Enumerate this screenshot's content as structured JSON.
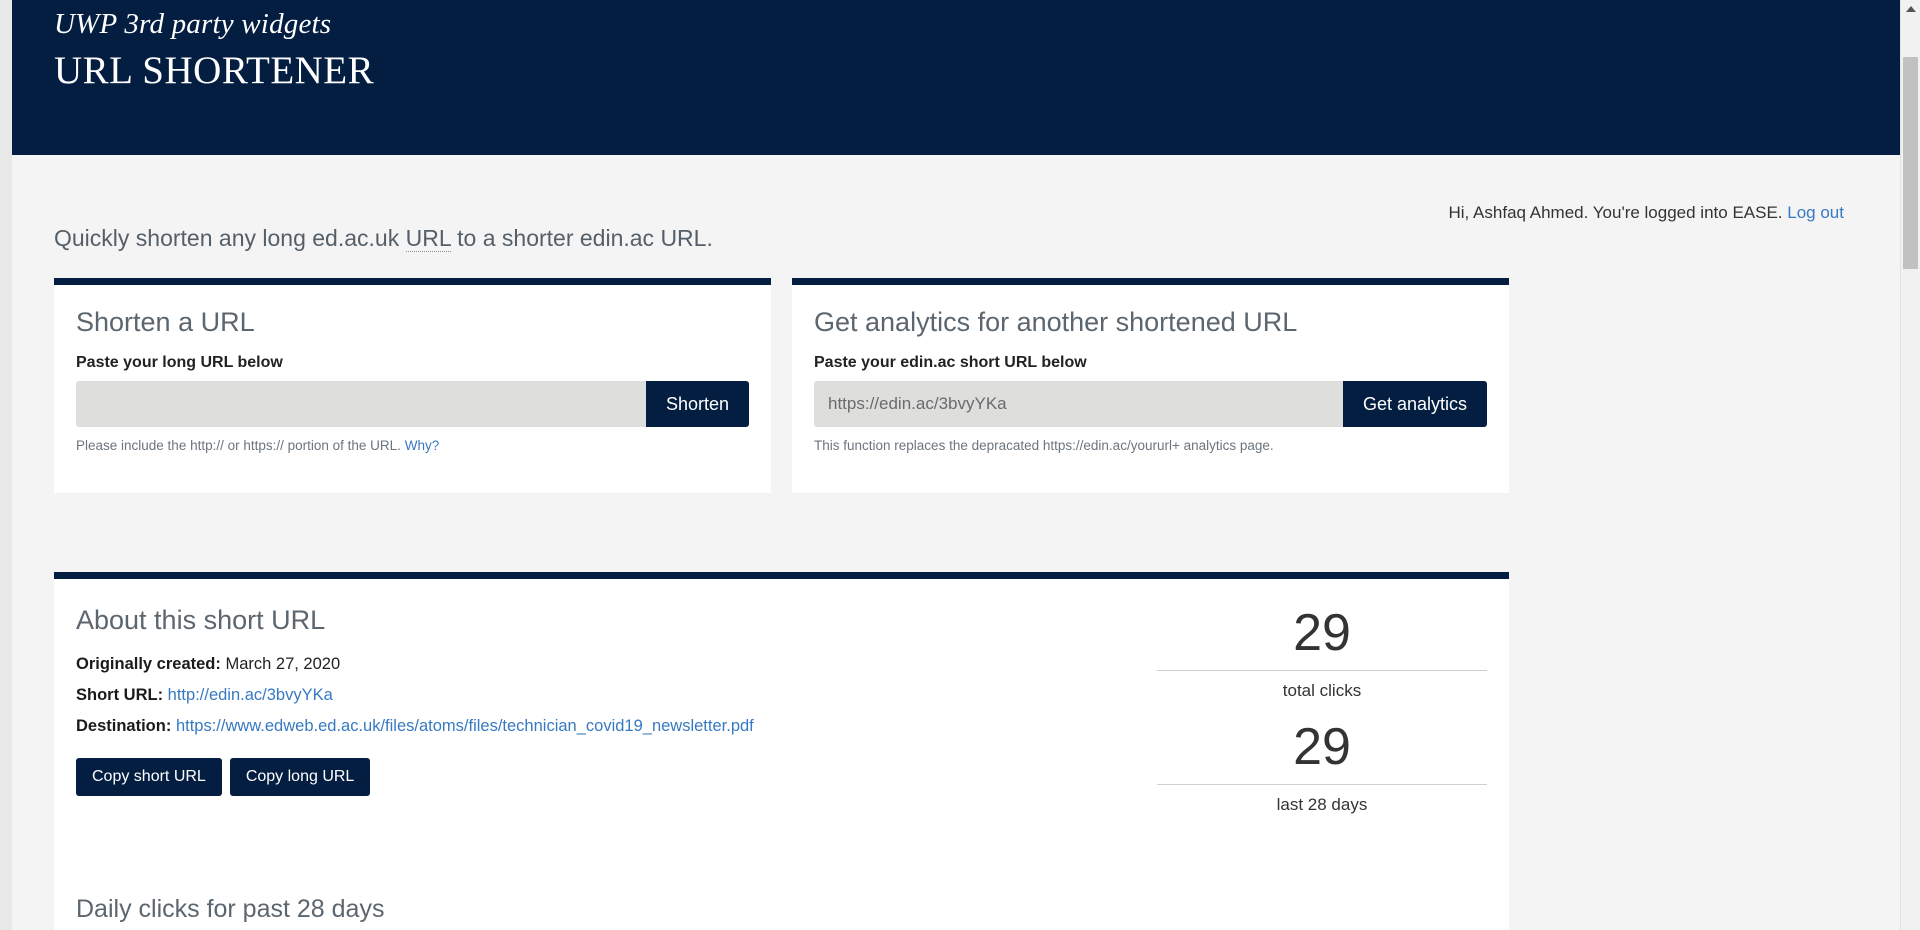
{
  "header": {
    "kicker": "UWP 3rd party widgets",
    "title": "URL SHORTENER",
    "background_color": "#041e42"
  },
  "account": {
    "greeting": "Hi, Ashfaq Ahmed. You're logged into EASE.",
    "logout_label": "Log out",
    "link_color": "#3779c2"
  },
  "intro": {
    "before_abbr": "Quickly shorten any long ed.ac.uk ",
    "abbr": "URL",
    "after_abbr": " to a shorter edin.ac URL."
  },
  "shorten_card": {
    "title": "Shorten a URL",
    "field_label": "Paste your long URL below",
    "input_value": "",
    "input_placeholder": "",
    "button_label": "Shorten",
    "help_text": "Please include the http:// or https:// portion of the URL.",
    "help_link_label": "Why?"
  },
  "analytics_card": {
    "title": "Get analytics for another shortened URL",
    "field_label": "Paste your edin.ac short URL below",
    "input_value": "",
    "input_placeholder": "https://edin.ac/3bvyYKa",
    "button_label": "Get analytics",
    "help_text": "This function replaces the depracated https://edin.ac/yoururl+ analytics page."
  },
  "detail_panel": {
    "title": "About this short URL",
    "meta": [
      {
        "key": "Originally created:",
        "value": " March 27, 2020",
        "is_link": false
      },
      {
        "key": "Short URL:",
        "value": " http://edin.ac/3bvyYKa",
        "is_link": true
      },
      {
        "key": "Destination:",
        "value": " https://www.edweb.ed.ac.uk/files/atoms/files/technician_covid19_newsletter.pdf",
        "is_link": true
      }
    ],
    "meta_created_key": "Originally created:",
    "meta_created_value": "March 27, 2020",
    "meta_short_key": "Short URL:",
    "meta_short_value": "http://edin.ac/3bvyYKa",
    "meta_dest_key": "Destination:",
    "meta_dest_value": "https://www.edweb.ed.ac.uk/files/atoms/files/technician_covid19_newsletter.pdf",
    "copy_short_label": "Copy short URL",
    "copy_long_label": "Copy long URL",
    "chart_section_title": "Daily clicks for past 28 days"
  },
  "stats": {
    "total_clicks_value": "29",
    "total_clicks_label": "total clicks",
    "last28_value": "29",
    "last28_label": "last 28 days"
  },
  "scrollbar": {
    "up_arrow_icon": "chevron-up-icon"
  }
}
